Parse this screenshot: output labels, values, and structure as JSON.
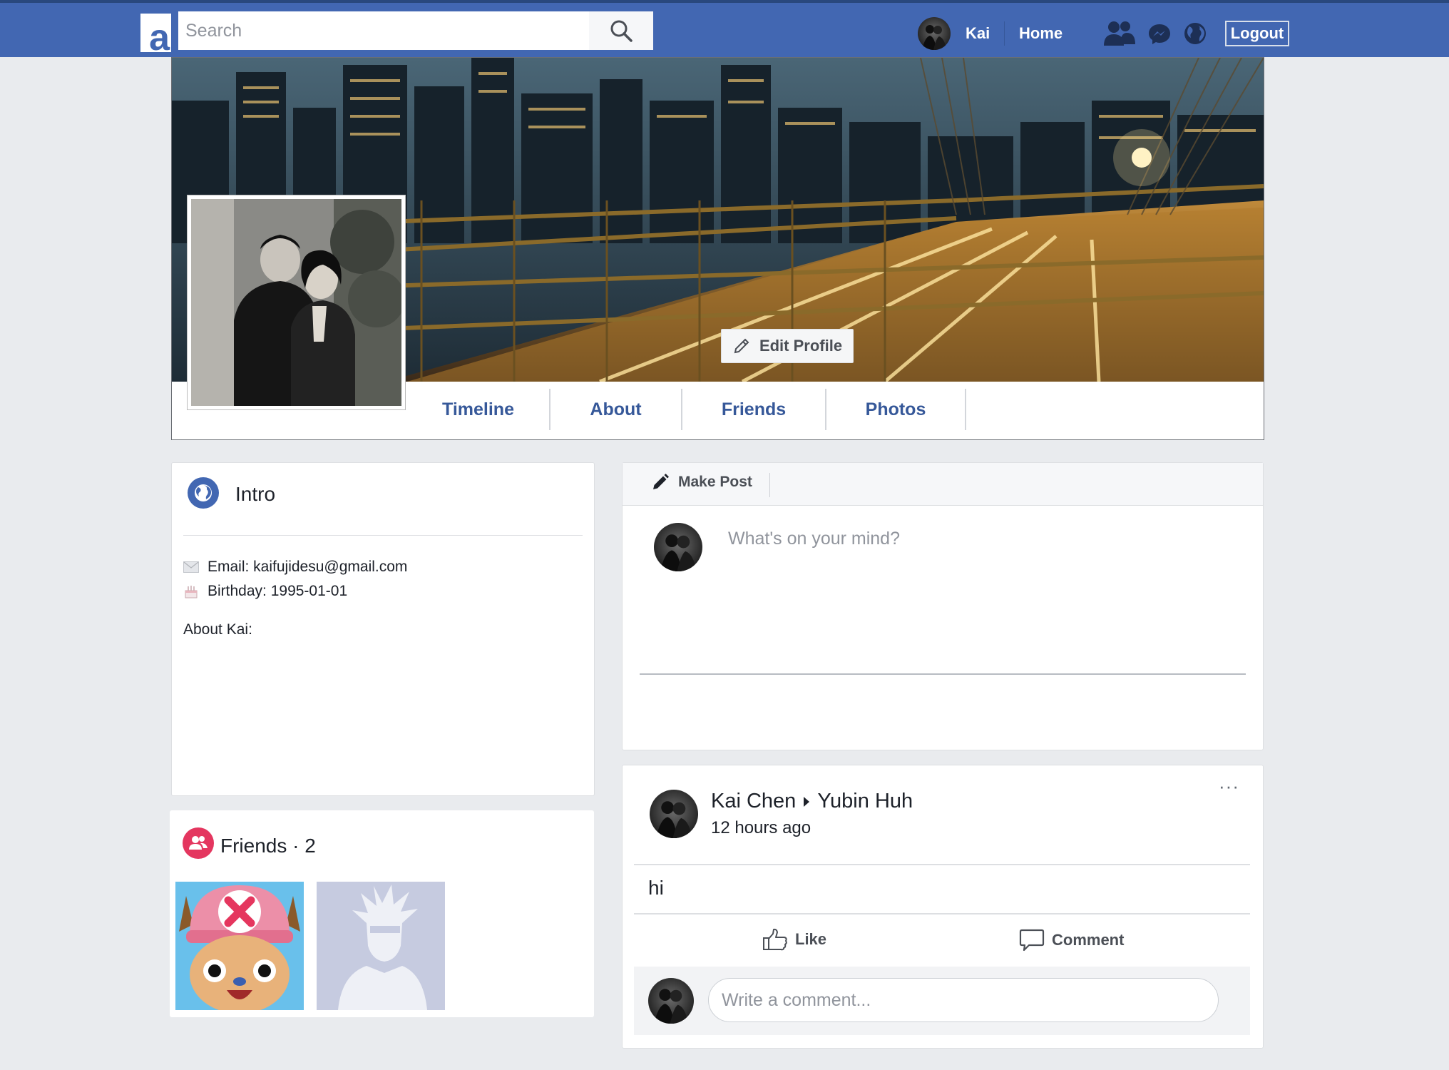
{
  "topbar": {
    "logo_letter": "a",
    "search_placeholder": "Search",
    "user_name": "Kai",
    "home_label": "Home",
    "logout_label": "Logout",
    "icons": [
      "search-icon",
      "friends-icon",
      "messenger-icon",
      "globe-icon"
    ]
  },
  "profile": {
    "edit_profile_label": "Edit Profile",
    "tabs": [
      "Timeline",
      "About",
      "Friends",
      "Photos"
    ]
  },
  "intro": {
    "title": "Intro",
    "email_label": "Email: kaifujidesu@gmail.com",
    "birthday_label": "Birthday: 1995-01-01",
    "about_label": "About Kai:"
  },
  "friends": {
    "title": "Friends · 2"
  },
  "make_post": {
    "tab_label": "Make Post",
    "placeholder": "What's on your mind?"
  },
  "post": {
    "author": "Kai Chen",
    "recipient": "Yubin Huh",
    "time": "12 hours ago",
    "body": "hi",
    "more": "···",
    "like_label": "Like",
    "comment_label": "Comment",
    "comment_placeholder": "Write a comment..."
  },
  "colors": {
    "brand_blue": "#4267b2",
    "link_blue": "#365899",
    "background": "#e9ebee",
    "friends_pink": "#e4365f"
  }
}
